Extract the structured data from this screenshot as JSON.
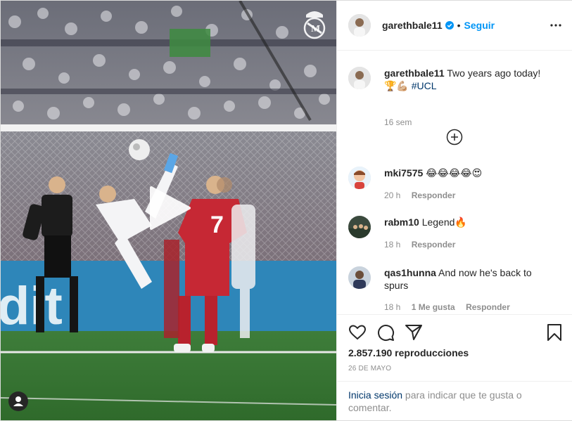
{
  "post": {
    "username": "garethbale11",
    "follow_label": "Seguir",
    "separator": "•",
    "caption": {
      "username": "garethbale11",
      "text": "Two years ago today!",
      "emojis": "🏆💪🏼",
      "hashtag": "#UCL",
      "time": "16 sem"
    },
    "comments": [
      {
        "username": "mki7575",
        "text": "😂😂😂😂😍",
        "time": "20 h",
        "likes": "",
        "reply": "Responder"
      },
      {
        "username": "rabm10",
        "text": "Legend🔥",
        "time": "18 h",
        "likes": "",
        "reply": "Responder"
      },
      {
        "username": "qas1hunna",
        "text": "And now he's back to spurs",
        "time": "18 h",
        "likes": "1 Me gusta",
        "reply": "Responder"
      }
    ],
    "views": "2.857.190 reproducciones",
    "date": "26 DE MAYO",
    "login": {
      "link": "Inicia sesión",
      "rest": " para indicar que te gusta o comentar."
    },
    "media": {
      "player_number": "7",
      "ad_text": "dit"
    }
  },
  "icons": {
    "verified": "verified-badge-icon",
    "more": "more-options-icon",
    "load_more": "plus-circle-icon",
    "like": "heart-icon",
    "comment": "comment-bubble-icon",
    "share": "paper-plane-icon",
    "save": "bookmark-icon",
    "play": "play-icon",
    "user_tag": "user-tag-icon"
  },
  "colors": {
    "accent": "#0095f6",
    "link": "#00376b",
    "muted": "#8e8e8e",
    "text": "#262626"
  }
}
